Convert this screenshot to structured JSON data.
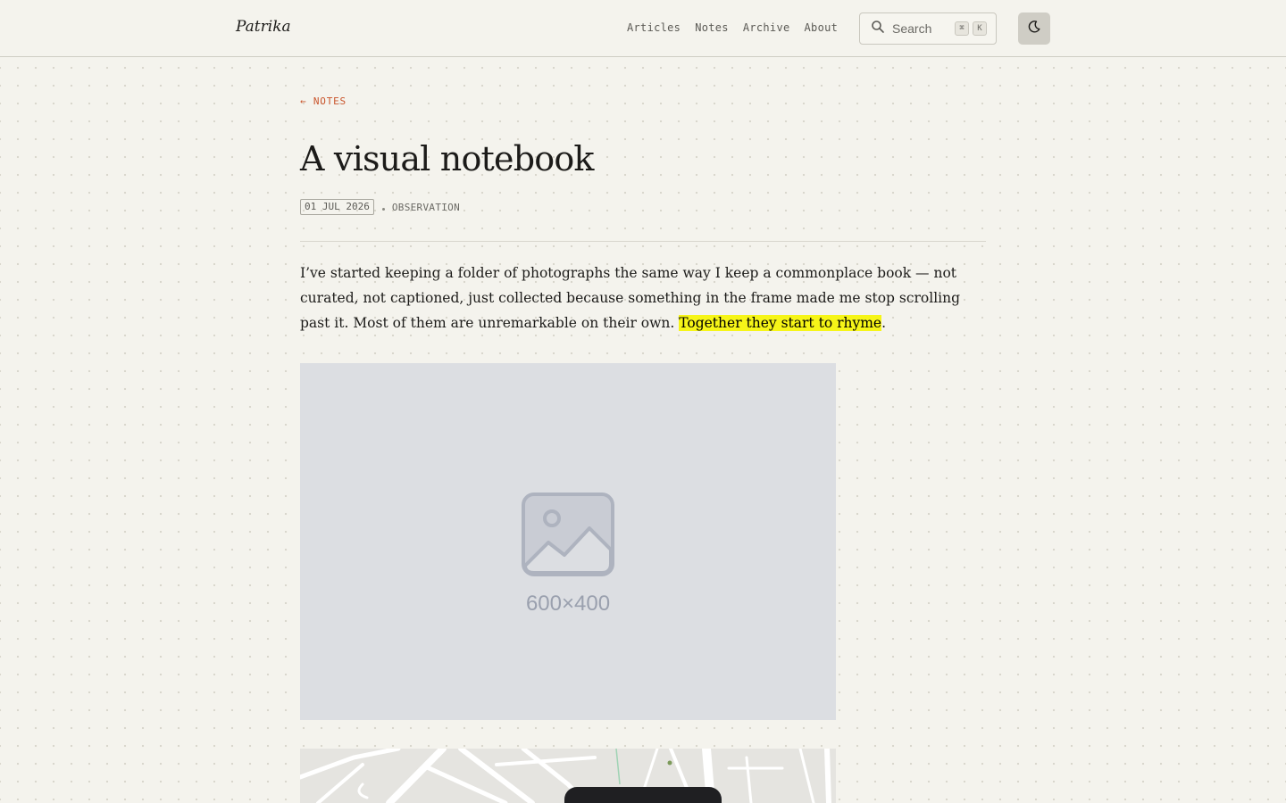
{
  "site": {
    "brand": "Patrika"
  },
  "nav": {
    "items": [
      "Articles",
      "Notes",
      "Archive",
      "About"
    ]
  },
  "search": {
    "placeholder": "Search",
    "shortcut_keys": [
      "⌘",
      "K"
    ],
    "icon": "search-icon"
  },
  "theme_toggle": {
    "icon": "moon-icon"
  },
  "breadcrumb": {
    "back_label": "← NOTES"
  },
  "article": {
    "title": "A visual notebook",
    "date": "01 JUL 2026",
    "tag": "OBSERVATION",
    "paragraph_before": "I’ve started keeping a folder of photographs the same way I keep a commonplace book — not curated, not captioned, just collected because something in the frame made me stop scrolling past it. Most of them are unremarkable on their own. ",
    "highlight": "Together they start to rhyme",
    "paragraph_after": "."
  },
  "image_placeholder": {
    "label": "600×400",
    "icon": "image-icon"
  },
  "colors": {
    "accent": "#c9552c",
    "highlight": "#f6f518",
    "background": "#f4f3ed"
  }
}
